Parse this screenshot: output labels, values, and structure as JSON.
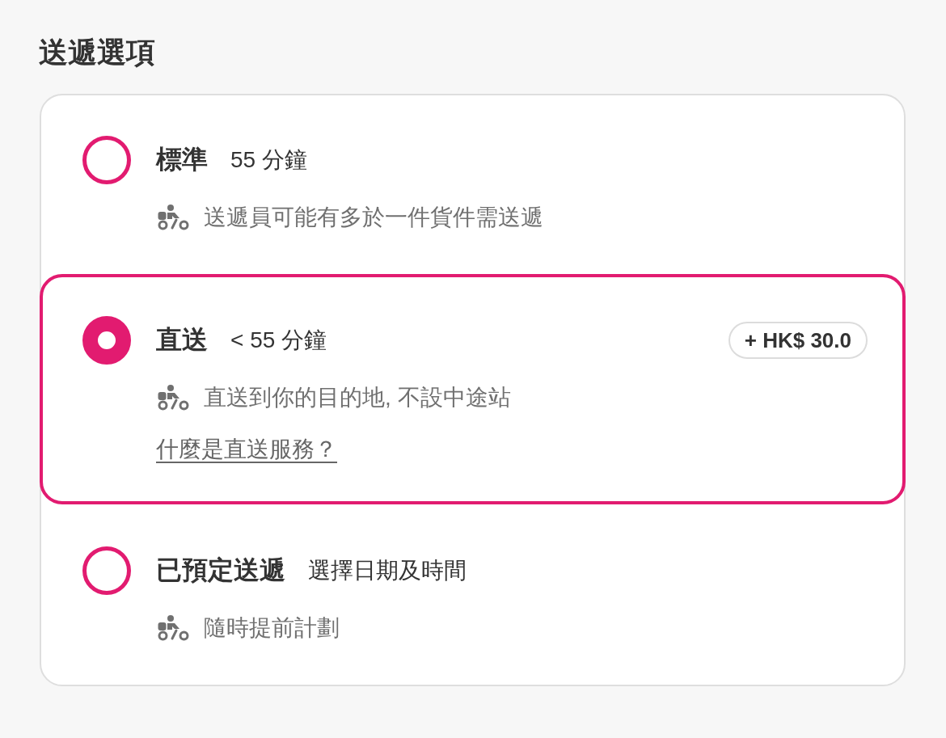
{
  "title": "送遞選項",
  "options": [
    {
      "name": "標準",
      "time": "55 分鐘",
      "selected": false,
      "note": "送遞員可能有多於一件貨件需送遞"
    },
    {
      "name": "直送",
      "time": "< 55 分鐘",
      "selected": true,
      "price": "+ HK$ 30.0",
      "note": "直送到你的目的地, 不設中途站",
      "link": "什麼是直送服務？"
    },
    {
      "name": "已預定送遞",
      "time": "選擇日期及時間",
      "selected": false,
      "note": "隨時提前計劃"
    }
  ]
}
